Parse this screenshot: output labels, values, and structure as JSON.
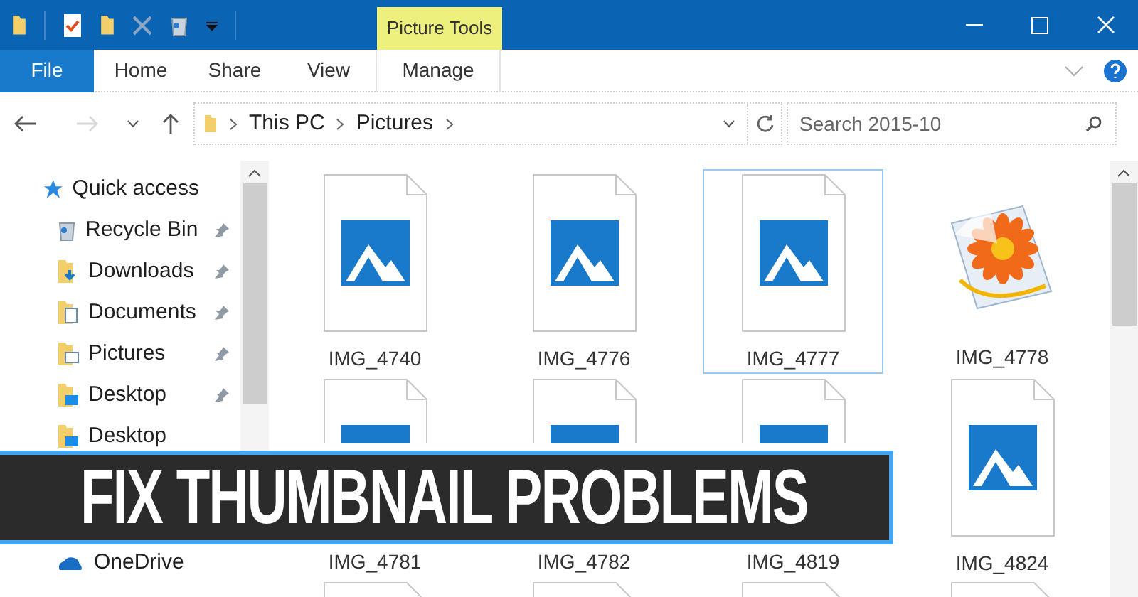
{
  "window": {
    "picture_tools": "Picture Tools"
  },
  "ribbon_tabs": [
    {
      "label": "File",
      "selected": true
    },
    {
      "label": "Home",
      "selected": false
    },
    {
      "label": "Share",
      "selected": false
    },
    {
      "label": "View",
      "selected": false
    },
    {
      "label": "Manage",
      "selected": false
    }
  ],
  "address": {
    "crumbs": [
      "This PC",
      "Pictures"
    ]
  },
  "search": {
    "placeholder": "Search 2015-10"
  },
  "sidebar": {
    "items": [
      {
        "label": "Quick access",
        "kind": "star",
        "pinned": false
      },
      {
        "label": "Recycle Bin",
        "kind": "recycle",
        "pinned": true
      },
      {
        "label": "Downloads",
        "kind": "downloads",
        "pinned": true
      },
      {
        "label": "Documents",
        "kind": "documents",
        "pinned": true
      },
      {
        "label": "Pictures",
        "kind": "pictures",
        "pinned": true
      },
      {
        "label": "Desktop",
        "kind": "desktop",
        "pinned": true
      },
      {
        "label": "Desktop",
        "kind": "desktop",
        "pinned": false
      }
    ],
    "bottom": [
      {
        "label": "OneDrive",
        "kind": "cloud",
        "pinned": false
      }
    ]
  },
  "files": [
    {
      "name": "IMG_4740",
      "kind": "file",
      "selected": false
    },
    {
      "name": "IMG_4776",
      "kind": "file",
      "selected": false
    },
    {
      "name": "IMG_4777",
      "kind": "file",
      "selected": true
    },
    {
      "name": "IMG_4778",
      "kind": "photo",
      "selected": false
    },
    {
      "name": "IMG_4781",
      "kind": "file",
      "selected": false
    },
    {
      "name": "IMG_4782",
      "kind": "file",
      "selected": false
    },
    {
      "name": "IMG_4819",
      "kind": "file",
      "selected": false
    },
    {
      "name": "IMG_4824",
      "kind": "file",
      "selected": false
    }
  ],
  "banner": {
    "title": "FIX THUMBNAIL PROBLEMS"
  }
}
